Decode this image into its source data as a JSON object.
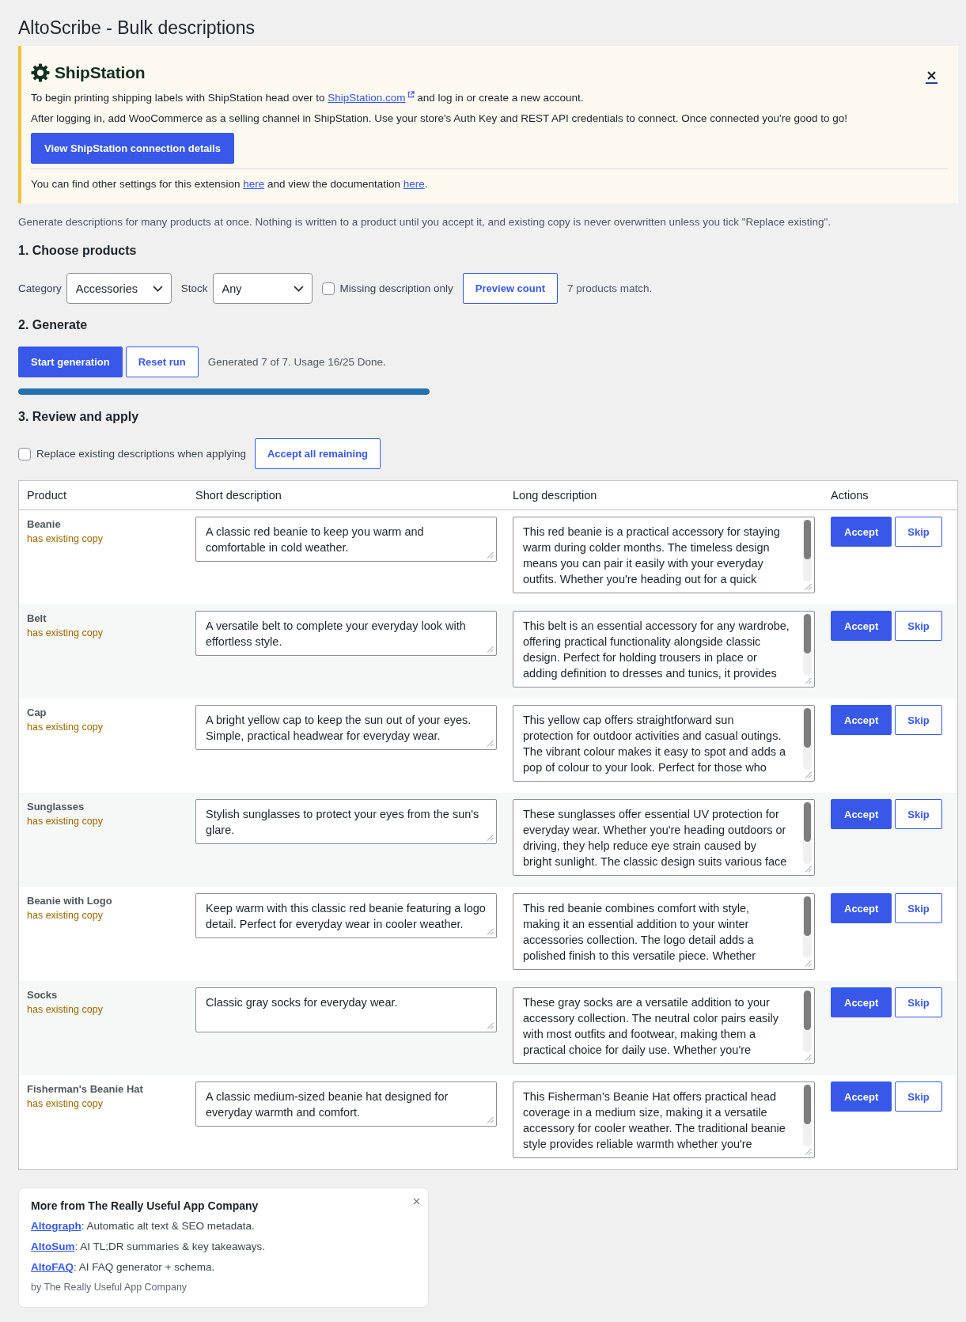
{
  "page": {
    "title": "AltoScribe - Bulk descriptions"
  },
  "notice": {
    "brand": "ShipStation",
    "line_1": {
      "before": "To begin printing shipping labels with ShipStation head over to ",
      "link": "ShipStation.com",
      "after": " and log in or create a new account."
    },
    "line_2": "After logging in, add WooCommerce as a selling channel in ShipStation. Use your store's Auth Key and REST API credentials to connect. Once connected you're good to go!",
    "button": "View ShipStation connection details",
    "footer": {
      "before": "You can find other settings for this extension ",
      "link_1": "here",
      "middle": " and view the documentation ",
      "link_2": "here",
      "after": "."
    }
  },
  "intro": "Generate descriptions for many products at once. Nothing is written to a product until you accept it, and existing copy is never overwritten unless you tick \"Replace existing\".",
  "choose": {
    "heading": "1. Choose products",
    "category": {
      "label": "Category",
      "value": "Accessories"
    },
    "stock": {
      "label": "Stock",
      "value": "Any"
    },
    "missing_only": {
      "label": "Missing description only",
      "checked": false
    },
    "preview_button": "Preview count",
    "match_text": "7 products match."
  },
  "generate": {
    "heading": "2. Generate",
    "start_button": "Start generation",
    "reset_button": "Reset run",
    "status": "Generated 7 of 7. Usage 16/25 Done.",
    "progress": {
      "level": 1
    }
  },
  "review": {
    "heading": "3. Review and apply",
    "replace_existing": {
      "label": "Replace existing descriptions when applying",
      "checked": false
    },
    "accept_all_button": "Accept all remaining"
  },
  "table": {
    "columns": [
      "Product",
      "Short description",
      "Long description",
      "Actions"
    ],
    "rows": [
      {
        "product": "Beanie",
        "note": "has existing copy",
        "short": "A classic red beanie to keep you warm and\ncomfortable in cold weather.",
        "long": "This red beanie is a practical accessory for staying\nwarm during colder months. The timeless design\nmeans you can pair it easily with your everyday\noutfits. Whether you're heading out for a quick",
        "actions": [
          {
            "label": "Accept",
            "kind": "primary"
          },
          {
            "label": "Skip",
            "kind": "secondary"
          }
        ]
      },
      {
        "product": "Belt",
        "note": "has existing copy",
        "short": "A versatile belt to complete your everyday look with\neffortless style.",
        "long": "This belt is an essential accessory for any wardrobe,\noffering practical functionality alongside classic\ndesign. Perfect for holding trousers in place or\nadding definition to dresses and tunics, it provides",
        "actions": [
          {
            "label": "Accept",
            "kind": "primary"
          },
          {
            "label": "Skip",
            "kind": "secondary"
          }
        ]
      },
      {
        "product": "Cap",
        "note": "has existing copy",
        "short": "A bright yellow cap to keep the sun out of your eyes.\nSimple, practical headwear for everyday wear.",
        "long": "This yellow cap offers straightforward sun\nprotection for outdoor activities and casual outings.\nThe vibrant colour makes it easy to spot and adds a\npop of colour to your look. Perfect for those who",
        "actions": [
          {
            "label": "Accept",
            "kind": "primary"
          },
          {
            "label": "Skip",
            "kind": "secondary"
          }
        ]
      },
      {
        "product": "Sunglasses",
        "note": "has existing copy",
        "short": "Stylish sunglasses to protect your eyes from the sun's\nglare.",
        "long": "These sunglasses offer essential UV protection for\neveryday wear. Whether you're heading outdoors or\ndriving, they help reduce eye strain caused by\nbright sunlight. The classic design suits various face",
        "actions": [
          {
            "label": "Accept",
            "kind": "primary"
          },
          {
            "label": "Skip",
            "kind": "secondary"
          }
        ]
      },
      {
        "product": "Beanie with Logo",
        "note": "has existing copy",
        "short": "Keep warm with this classic red beanie featuring a logo\ndetail. Perfect for everyday wear in cooler weather.",
        "long": "This red beanie combines comfort with style,\nmaking it an essential addition to your winter\naccessories collection. The logo detail adds a\npolished finish to this versatile piece. Whether",
        "actions": [
          {
            "label": "Accept",
            "kind": "primary"
          },
          {
            "label": "Skip",
            "kind": "secondary"
          }
        ]
      },
      {
        "product": "Socks",
        "note": "has existing copy",
        "short": "Classic gray socks for everyday wear.",
        "long": "These gray socks are a versatile addition to your\naccessory collection. The neutral color pairs easily\nwith most outfits and footwear, making them a\npractical choice for daily use. Whether you're",
        "actions": [
          {
            "label": "Accept",
            "kind": "primary"
          },
          {
            "label": "Skip",
            "kind": "secondary"
          }
        ]
      },
      {
        "product": "Fisherman's Beanie Hat",
        "note": "has existing copy",
        "short": "A classic medium-sized beanie hat designed for\neveryday warmth and comfort.",
        "long": "This Fisherman's Beanie Hat offers practical head\ncoverage in a medium size, making it a versatile\naccessory for cooler weather. The traditional beanie\nstyle provides reliable warmth whether you're",
        "actions": [
          {
            "label": "Accept",
            "kind": "primary"
          },
          {
            "label": "Skip",
            "kind": "secondary"
          }
        ]
      }
    ]
  },
  "promo": {
    "title": "More from The Really Useful App Company",
    "items": [
      {
        "link": "Altograph",
        "text": ": Automatic alt text & SEO metadata."
      },
      {
        "link": "AltoSum",
        "text": ": AI TL;DR summaries & key takeaways."
      },
      {
        "link": "AltoFAQ",
        "text": ": AI FAQ generator + schema."
      }
    ],
    "byline": "by The Really Useful App Company"
  }
}
